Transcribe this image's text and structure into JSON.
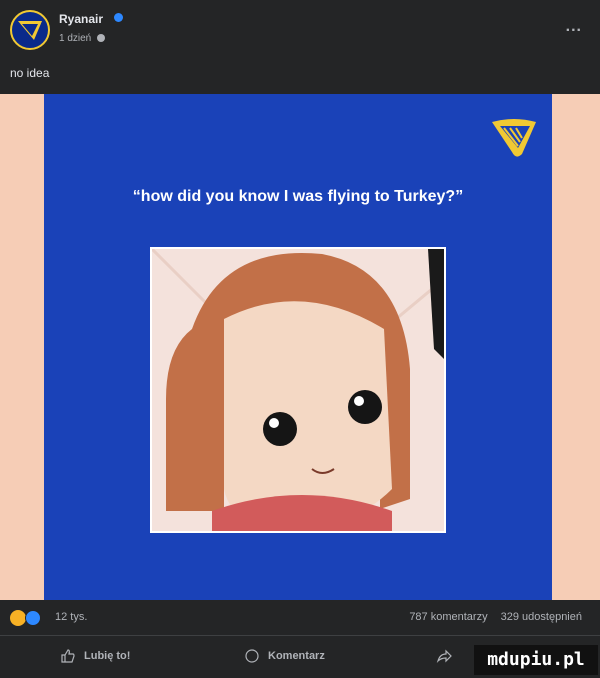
{
  "post": {
    "page_name": "Ryanair",
    "time": "1 dzień",
    "caption": "no idea",
    "more_label": "...",
    "icons": {
      "avatar": "ryanair-harp-logo",
      "verified": "verified-badge-icon",
      "audience": "globe-icon"
    }
  },
  "image": {
    "headline": "“how did you know I was flying to Turkey?”",
    "colors": {
      "panel": "#1a42b8",
      "side": "#f6cdb6"
    }
  },
  "stats": {
    "reactions": "12 tys.",
    "comments": "787 komentarzy",
    "shares": "329 udostępnień"
  },
  "actions": {
    "like": "Lubię to!",
    "comment": "Komentarz"
  },
  "watermark": "mdupiu.pl"
}
